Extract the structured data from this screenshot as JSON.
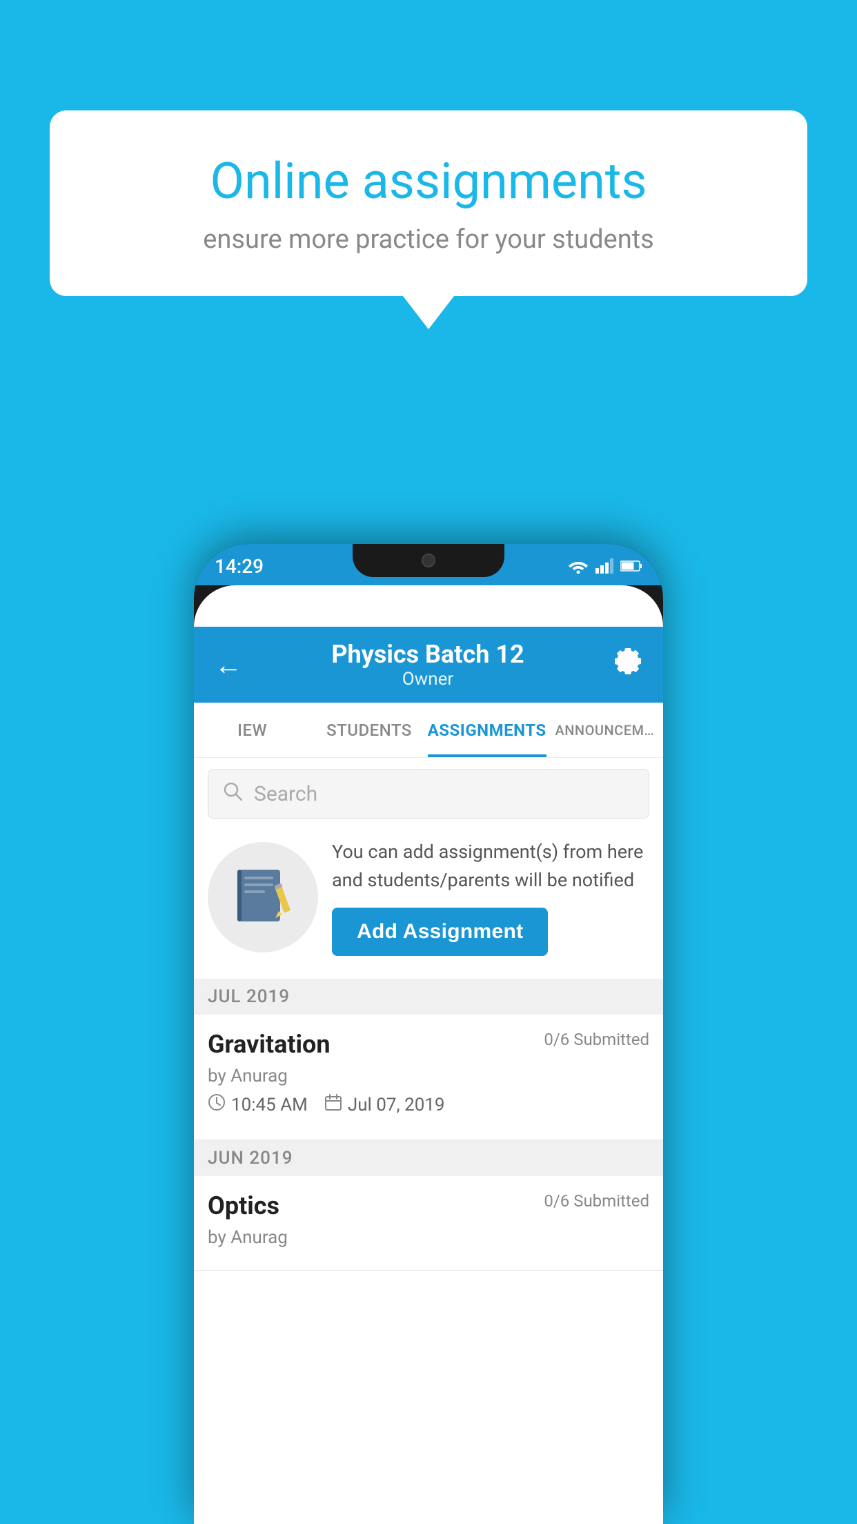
{
  "background": {
    "color": "#1ab8e8"
  },
  "speech_bubble": {
    "title": "Online assignments",
    "subtitle": "ensure more practice for your students"
  },
  "phone": {
    "status_bar": {
      "time": "14:29",
      "icons": [
        "wifi",
        "signal",
        "battery"
      ]
    },
    "header": {
      "back_label": "←",
      "batch_name": "Physics Batch 12",
      "owner_label": "Owner",
      "settings_label": "⚙"
    },
    "tabs": [
      {
        "label": "IEW",
        "active": false
      },
      {
        "label": "STUDENTS",
        "active": false
      },
      {
        "label": "ASSIGNMENTS",
        "active": true
      },
      {
        "label": "ANNOUNCEM…",
        "active": false
      }
    ],
    "search": {
      "placeholder": "Search"
    },
    "promo": {
      "description": "You can add assignment(s) from here and students/parents will be notified",
      "add_button_label": "Add Assignment"
    },
    "sections": [
      {
        "header": "JUL 2019",
        "assignments": [
          {
            "name": "Gravitation",
            "submitted": "0/6 Submitted",
            "by": "by Anurag",
            "time": "10:45 AM",
            "date": "Jul 07, 2019"
          }
        ]
      },
      {
        "header": "JUN 2019",
        "assignments": [
          {
            "name": "Optics",
            "submitted": "0/6 Submitted",
            "by": "by Anurag",
            "time": "",
            "date": ""
          }
        ]
      }
    ]
  }
}
